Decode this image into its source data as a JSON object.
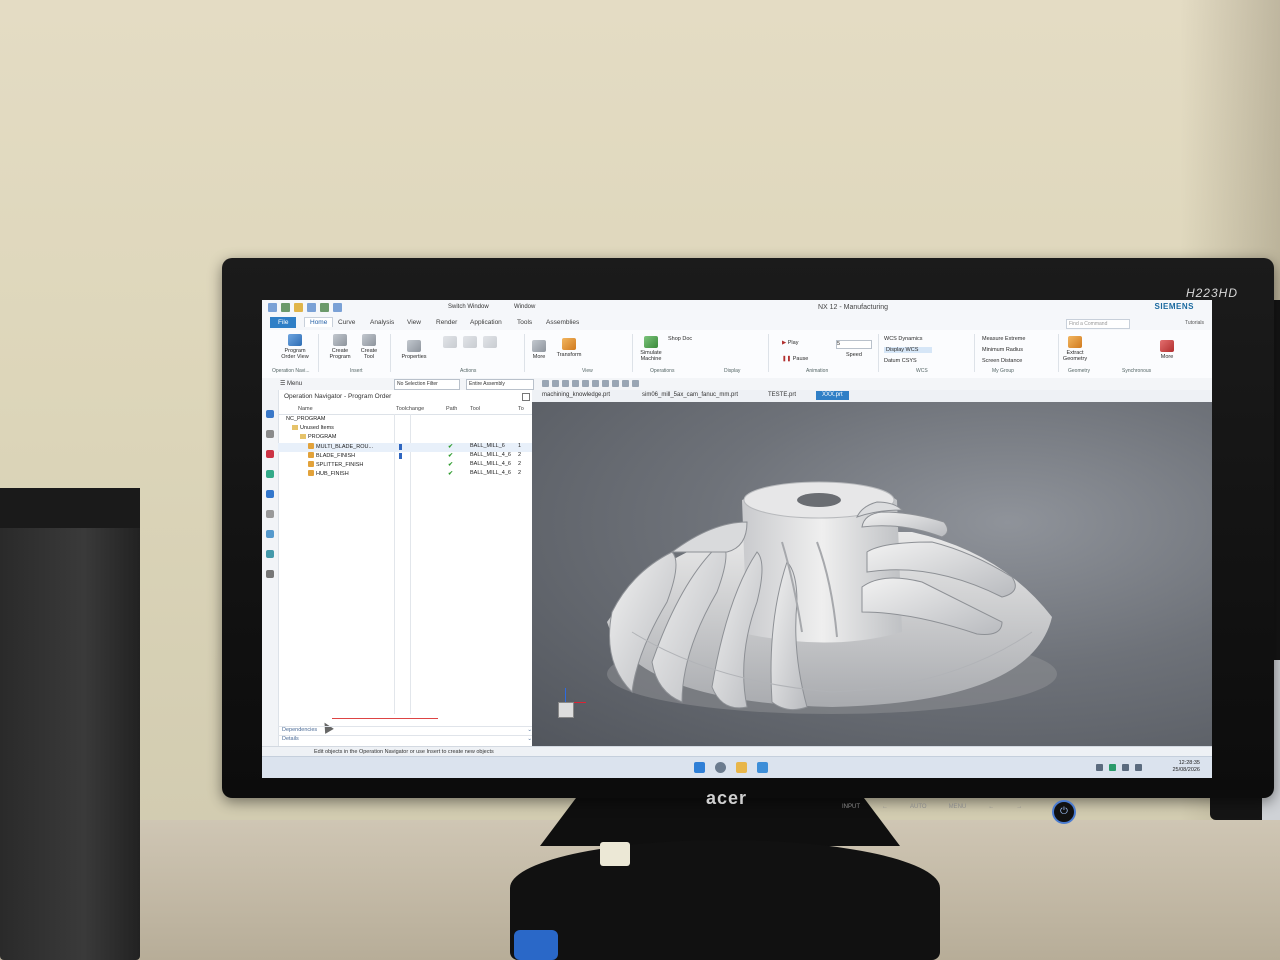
{
  "monitor": {
    "model": "H223HD",
    "brand": "acer",
    "front_buttons": [
      "INPUT",
      "←",
      "AUTO",
      "MENU",
      "←",
      "→"
    ]
  },
  "app": {
    "title": "NX 12 - Manufacturing",
    "vendor": "SIEMENS",
    "switch_window": "Switch Window",
    "window": "Window",
    "search_placeholder": "Find a Command",
    "tutorial": "Tutorials"
  },
  "tabs": [
    "File",
    "Home",
    "Curve",
    "Analysis",
    "View",
    "Render",
    "Application",
    "Tools",
    "Assemblies"
  ],
  "ribbon": {
    "program_order_view": "Program Order View",
    "create_program": "Create Program",
    "create_tool": "Create Tool",
    "properties": "Properties",
    "more_1": "More",
    "transform": "Transform",
    "simulate_machine": "Simulate Machine",
    "shop_doc": "Shop Doc",
    "play": "Play",
    "pause": "Pause",
    "speed": "Speed",
    "speed_value": "5",
    "wcs_dynamics": "WCS Dynamics",
    "display_wcs": "Display WCS",
    "datum_csys": "Datum CSYS",
    "measure_extreme": "Measure Extreme",
    "minimum_radius": "Minimum Radius",
    "screen_distance": "Screen Distance",
    "extract_geometry": "Extract Geometry",
    "more_2": "More",
    "groups": [
      "Operation Navi...",
      "Insert",
      "Actions",
      "View",
      "Operations",
      "Display",
      "Animation",
      "WCS",
      "My Group",
      "Geometry",
      "Synchronous"
    ]
  },
  "toolbar2": {
    "menu": "Menu",
    "selection_filter": "No Selection Filter",
    "assembly": "Entire Assembly"
  },
  "navigator": {
    "title": "Operation Navigator - Program Order",
    "columns": [
      "Name",
      "Toolchange",
      "Path",
      "Tool",
      "To"
    ],
    "rows": [
      {
        "name": "NC_PROGRAM",
        "tool": "",
        "to": ""
      },
      {
        "name": "Unused Items",
        "tool": "",
        "to": ""
      },
      {
        "name": "PROGRAM",
        "tool": "",
        "to": ""
      },
      {
        "name": "MULTI_BLADE_ROU...",
        "tool": "BALL_MILL_6",
        "to": "1"
      },
      {
        "name": "BLADE_FINISH",
        "tool": "BALL_MILL_4_6",
        "to": "2"
      },
      {
        "name": "SPLITTER_FINISH",
        "tool": "BALL_MILL_4_6",
        "to": "2"
      },
      {
        "name": "HUB_FINISH",
        "tool": "BALL_MILL_4_6",
        "to": "2"
      }
    ],
    "dependencies": "Dependencies",
    "details": "Details"
  },
  "doc_tabs": [
    "machining_knowledge.prt",
    "sim06_mill_5ax_cam_fanuc_mm.prt",
    "TESTE.prt",
    "XXX.prt"
  ],
  "status": "Edit objects in the Operation Navigator or use Insert to create new objects",
  "taskbar": {
    "time": "12:28:35",
    "date": "25/08/2026"
  }
}
